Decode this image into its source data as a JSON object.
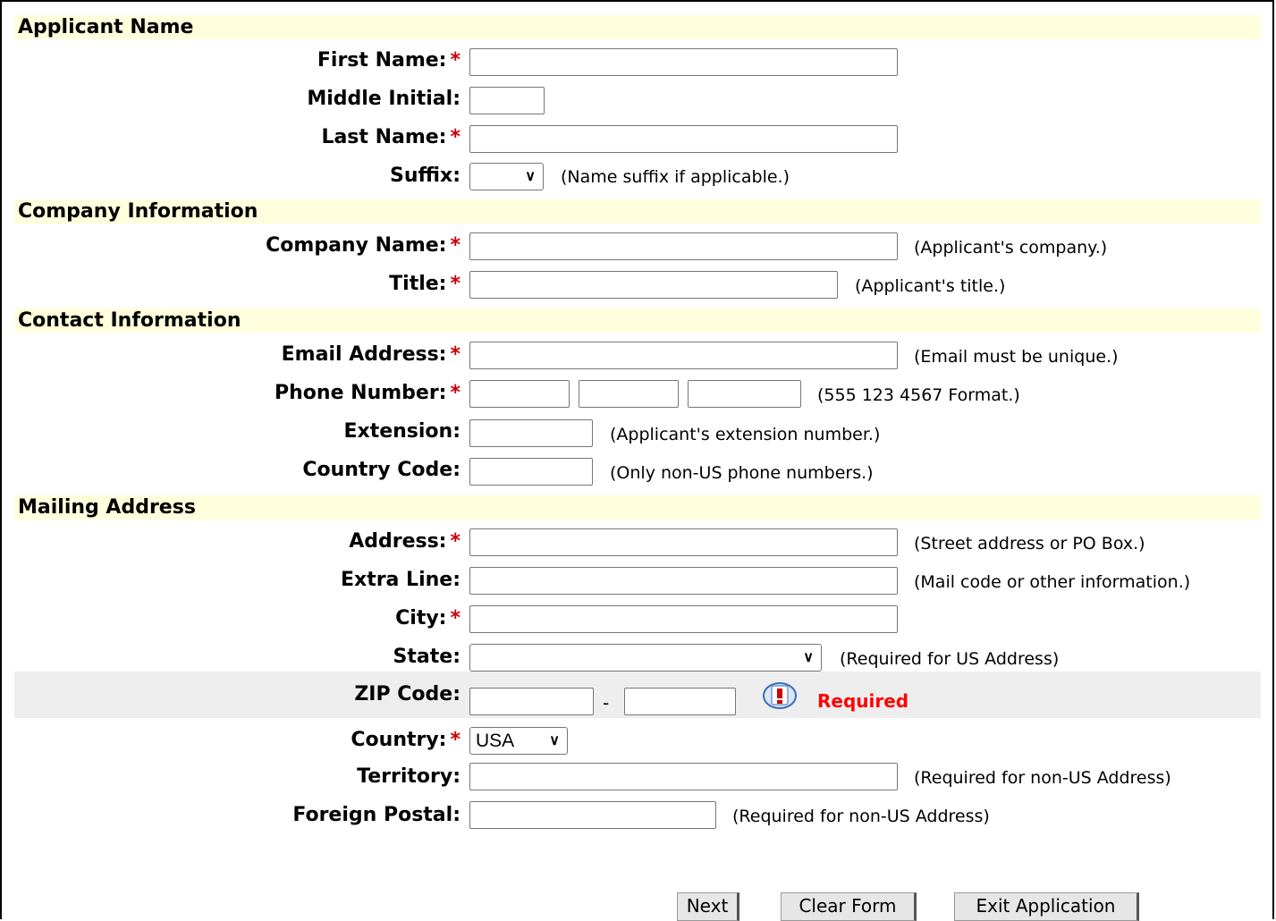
{
  "sections": {
    "applicant": "Applicant Name",
    "company": "Company Information",
    "contact": "Contact Information",
    "mailing": "Mailing Address"
  },
  "required_marker": "*",
  "fields": {
    "first_name": "First Name:",
    "middle_initial": "Middle Initial:",
    "last_name": "Last Name:",
    "suffix": "Suffix:",
    "company_name": "Company Name:",
    "title": "Title:",
    "email": "Email Address:",
    "phone": "Phone Number:",
    "extension": "Extension:",
    "country_code": "Country Code:",
    "address": "Address:",
    "extra_line": "Extra Line:",
    "city": "City:",
    "state": "State:",
    "zip": "ZIP Code:",
    "country": "Country:",
    "territory": "Territory:",
    "foreign_postal": "Foreign Postal:"
  },
  "hints": {
    "suffix": "(Name suffix if applicable.)",
    "company_name": "(Applicant's company.)",
    "title": "(Applicant's title.)",
    "email": "(Email must be unique.)",
    "phone": "(555 123 4567 Format.)",
    "extension": "(Applicant's extension number.)",
    "country_code": "(Only non-US phone numbers.)",
    "address": "(Street address or PO Box.)",
    "extra_line": "(Mail code or other information.)",
    "state": "(Required for US Address)",
    "territory": "(Required for non-US Address)",
    "foreign_postal": "(Required for non-US Address)"
  },
  "values": {
    "suffix": "",
    "state": "",
    "country": "USA"
  },
  "zip_separator": "-",
  "zip_error": "Required",
  "buttons": {
    "next": "Next",
    "clear": "Clear Form",
    "exit": "Exit Application"
  },
  "colors": {
    "section_bg": "#ffffdd",
    "required": "#cc0000",
    "error": "#ff0000",
    "error_row_bg": "#eeeeee"
  }
}
